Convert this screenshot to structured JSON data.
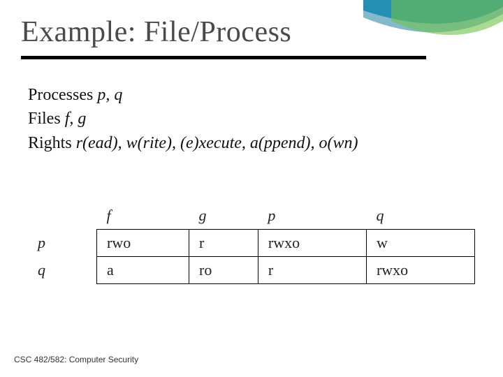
{
  "title": "Example: File/Process",
  "body": {
    "processes": {
      "label": "Processes ",
      "items": "p, q"
    },
    "files": {
      "label": "Files ",
      "items": "f, g"
    },
    "rights": {
      "label": "Rights ",
      "items": "r(ead), w(rite), (e)xecute, a(ppend), o(wn)"
    }
  },
  "chart_data": {
    "type": "table",
    "columns": [
      "f",
      "g",
      "p",
      "q"
    ],
    "rows": [
      "p",
      "q"
    ],
    "cells": [
      [
        "rwo",
        "r",
        "rwxo",
        "w"
      ],
      [
        "a",
        "ro",
        "r",
        "rwxo"
      ]
    ]
  },
  "footer": "CSC 482/582: Computer Security"
}
